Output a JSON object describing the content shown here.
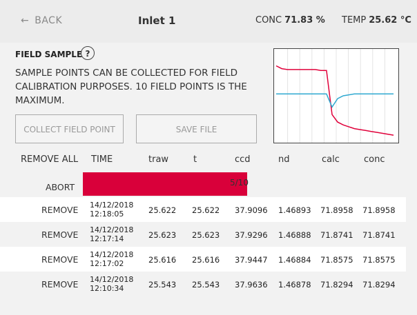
{
  "header": {
    "back_label": "BACK",
    "title": "Inlet 1",
    "conc_label": "CONC",
    "conc_value": "71.83 %",
    "temp_label": "TEMP",
    "temp_value": "25.62 °C"
  },
  "field_sample": {
    "title": "FIELD SAMPLE",
    "help": "?",
    "description": "SAMPLE POINTS CAN BE COLLECTED FOR FIELD CALIBRATION PURPOSES. 10 FIELD POINTS IS THE MAXIMUM.",
    "collect_label": "COLLECT FIELD POINT",
    "save_label": "SAVE FILE"
  },
  "chart_data": {
    "type": "line",
    "series": [
      {
        "color": "#e0003a",
        "values": [
          0.82,
          0.79,
          0.78,
          0.78,
          0.78,
          0.78,
          0.78,
          0.78,
          0.77,
          0.77,
          0.3,
          0.22,
          0.19,
          0.17,
          0.15,
          0.14,
          0.13,
          0.12,
          0.11,
          0.1,
          0.09,
          0.08
        ]
      },
      {
        "color": "#2ea8d0",
        "values": [
          0.52,
          0.52,
          0.52,
          0.52,
          0.52,
          0.52,
          0.52,
          0.52,
          0.52,
          0.52,
          0.38,
          0.47,
          0.5,
          0.51,
          0.52,
          0.52,
          0.52,
          0.52,
          0.52,
          0.52,
          0.52,
          0.52
        ]
      }
    ],
    "grid": true
  },
  "table": {
    "headers": [
      "REMOVE ALL",
      "TIME",
      "traw",
      "t",
      "ccd",
      "nd",
      "calc",
      "conc"
    ],
    "abort_label": "ABORT",
    "progress_text": "5/10",
    "progress_fraction": 0.5,
    "rows": [
      {
        "remove": "REMOVE",
        "date": "14/12/2018",
        "time": "12:18:05",
        "traw": "25.622",
        "t": "25.622",
        "ccd": "37.9096",
        "nd": "1.46893",
        "calc": "71.8958",
        "conc": "71.8958"
      },
      {
        "remove": "REMOVE",
        "date": "14/12/2018",
        "time": "12:17:14",
        "traw": "25.623",
        "t": "25.623",
        "ccd": "37.9296",
        "nd": "1.46888",
        "calc": "71.8741",
        "conc": "71.8741"
      },
      {
        "remove": "REMOVE",
        "date": "14/12/2018",
        "time": "12:17:02",
        "traw": "25.616",
        "t": "25.616",
        "ccd": "37.9447",
        "nd": "1.46884",
        "calc": "71.8575",
        "conc": "71.8575"
      },
      {
        "remove": "REMOVE",
        "date": "14/12/2018",
        "time": "12:10:34",
        "traw": "25.543",
        "t": "25.543",
        "ccd": "37.9636",
        "nd": "1.46878",
        "calc": "71.8294",
        "conc": "71.8294"
      }
    ]
  }
}
